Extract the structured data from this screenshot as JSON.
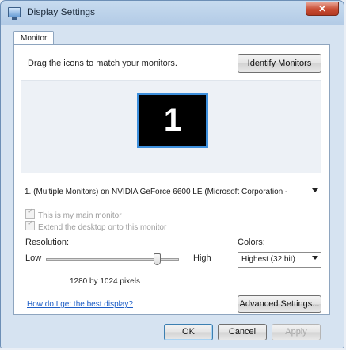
{
  "window": {
    "title": "Display Settings",
    "close_glyph": "✕"
  },
  "tabs": [
    {
      "label": "Monitor"
    }
  ],
  "monitor_panel": {
    "instruction": "Drag the icons to match your monitors.",
    "identify_label": "Identify Monitors",
    "monitor_number": "1",
    "selected_display": "1. (Multiple Monitors) on NVIDIA GeForce 6600 LE (Microsoft Corporation -",
    "checkbox_main": "This is my main monitor",
    "checkbox_extend": "Extend the desktop onto this monitor"
  },
  "resolution": {
    "label": "Resolution:",
    "low_label": "Low",
    "high_label": "High",
    "slider_level": 0.84,
    "value_text": "1280 by 1024 pixels"
  },
  "colors": {
    "label": "Colors:",
    "selected": "Highest (32 bit)"
  },
  "help_link": "How do I get the best display?",
  "advanced_label": "Advanced Settings...",
  "buttons": {
    "ok": "OK",
    "cancel": "Cancel",
    "apply": "Apply"
  },
  "icons": {
    "app": "display-settings-icon",
    "close": "close-icon",
    "dropdown": "chevron-down-icon",
    "checkbox": "checkmark-icon"
  }
}
